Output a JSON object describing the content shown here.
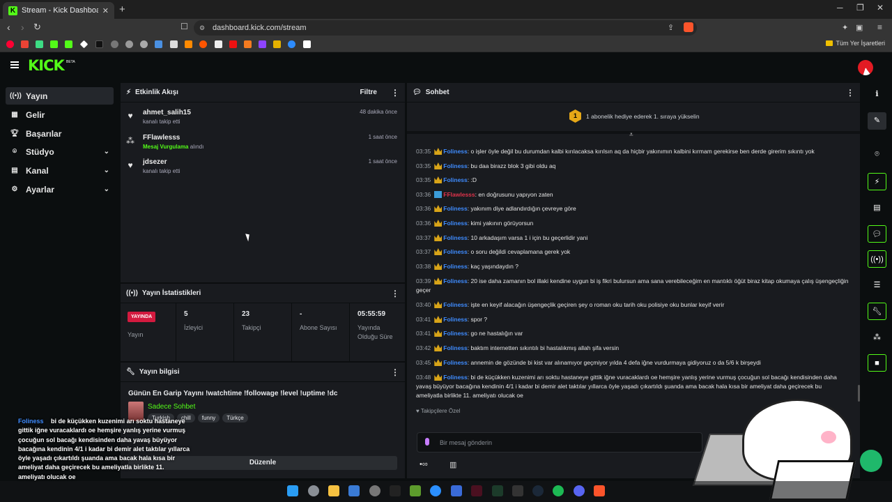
{
  "browser": {
    "tab_title": "Stream - Kick Dashboard",
    "url": "dashboard.kick.com/stream",
    "bookmarks_right": "Tüm Yer İşaretleri"
  },
  "brand": {
    "logo": "KICK",
    "beta": "BETA",
    "accent": "#53fc18"
  },
  "sidebar": {
    "items": [
      {
        "label": "Yayın",
        "icon": "broadcast-icon"
      },
      {
        "label": "Gelir",
        "icon": "revenue-icon"
      },
      {
        "label": "Başarılar",
        "icon": "trophy-icon"
      },
      {
        "label": "Stüdyo",
        "icon": "studio-icon"
      },
      {
        "label": "Kanal",
        "icon": "channel-icon"
      },
      {
        "label": "Ayarlar",
        "icon": "gear-icon"
      }
    ]
  },
  "activity": {
    "title": "Etkinlik Akışı",
    "filter": "Filtre",
    "events": [
      {
        "user": "ahmet_salih15",
        "sub": "kanalı takip etti",
        "time": "48 dakika önce"
      },
      {
        "user": "FFlawlesss",
        "highlight": "Mesaj Vurgulama",
        "sub": "alındı",
        "time": "1 saat önce"
      },
      {
        "user": "jdsezer",
        "sub": "kanalı takip etti",
        "time": "1 saat önce"
      }
    ]
  },
  "stats": {
    "title": "Yayın İstatistikleri",
    "live_badge": "YAYINDA",
    "live_label": "Yayın",
    "viewers": "5",
    "viewers_label": "İzleyici",
    "followers": "23",
    "followers_label": "Takipçi",
    "subs": "-",
    "subs_label": "Abone Sayısı",
    "duration": "05:55:59",
    "duration_label": "Yayında Olduğu Süre"
  },
  "info": {
    "title": "Yayın bilgisi",
    "stream_title": "Günün En Garip Yayını !watchtime !followage !level !uptime !dc",
    "category": "Sadece Sohbet",
    "tags": [
      "Turkish",
      "chill",
      "funny",
      "Türkçe"
    ],
    "edit": "Düzenle"
  },
  "chat": {
    "title": "Sohbet",
    "goal": "1 abonelik hediye ederek 1. sıraya yükselin",
    "goal_rank": "1",
    "messages": [
      {
        "t": "03:35",
        "u": "Foliness",
        "m": ": o işler öyle değil bu durumdan kalbi kırılacaksa kırılsın aq da hiçbir yakınımın kalbini kırmam gerekirse ben derde girerim sıkıntı yok"
      },
      {
        "t": "03:35",
        "u": "Foliness",
        "m": ": bu daa birazz blok 3 gibi oldu aq"
      },
      {
        "t": "03:35",
        "u": "Foliness",
        "m": ": :D"
      },
      {
        "t": "03:36",
        "u": "FFlawlesss",
        "m": ": en doğrusunu yapıyon zaten"
      },
      {
        "t": "03:36",
        "u": "Foliness",
        "m": ": yakınım diye adlandırdığın çevreye göre"
      },
      {
        "t": "03:36",
        "u": "Foliness",
        "m": ": kimi yakının görüyorsun"
      },
      {
        "t": "03:37",
        "u": "Foliness",
        "m": ": 10 arkadaşım varsa 1 i için bu geçerlidir yani"
      },
      {
        "t": "03:37",
        "u": "Foliness",
        "m": ": o soru değildi cevaplamana gerek yok"
      },
      {
        "t": "03:38",
        "u": "Foliness",
        "m": ": kaç yaşındaydın ?"
      },
      {
        "t": "03:39",
        "u": "Foliness",
        "m": ": 20 ise daha zamanın bol illaki kendine uygun bi iş fikri bulursun ama sana verebileceğim en mantıklı öğüt biraz kitap okumaya çalış üşengeçliğin geçer"
      },
      {
        "t": "03:40",
        "u": "Foliness",
        "m": ": işte en keyif alacağın üşengeçlik geçiren şey o roman oku tarih oku polisiye oku bunlar keyif verir"
      },
      {
        "t": "03:41",
        "u": "Foliness",
        "m": ": spor ?"
      },
      {
        "t": "03:41",
        "u": "Foliness",
        "m": ": go ne hastalığın var"
      },
      {
        "t": "03:42",
        "u": "Foliness",
        "m": ": baktım internetten sıkıntılı bi hastalıkmış allah şifa versin"
      },
      {
        "t": "03:45",
        "u": "Foliness",
        "m": ": annemin de gözünde bi kist var alınamıyor geçmiyor yılda 4 defa iğne vurdurmaya gidiyoruz o da 5/6 k birşeydi"
      },
      {
        "t": "03:48",
        "u": "Foliness",
        "m": ": bi de küçükken kuzenimi arı soktu hastaneye gittik iğne vuracaklardı oe hemşire yanlış yerine vurmuş çocuğun sol bacağı kendisinden daha yavaş büyüyor bacağına kendinin 4/1 i kadar bi demir alet taktılar yıllarca öyle yaşadı çıkartıldı şuanda ama bacak hala kısa bir ameliyat daha geçirecek bu ameliyatla birlikte 11. ameliyatı olucak oe"
      }
    ],
    "followers_only": "Takipçilere Özel",
    "placeholder": "Bir mesaj gönderin"
  },
  "overlay": {
    "user": "Foliness",
    "text": "bi de küçükken kuzenimi arı soktu hastaneye gittik iğne vuracaklardı oe hemşire yanlış yerine vurmuş çocuğun sol bacağı kendisinden daha yavaş büyüyor bacağına kendinin 4/1 i kadar bi demir alet taktılar yıllarca öyle yaşadı çıkartıldı şuanda ama bacak hala kısa bir ameliyat daha geçirecek bu ameliyatla birlikte 11. ameliyatı olucak oe"
  }
}
